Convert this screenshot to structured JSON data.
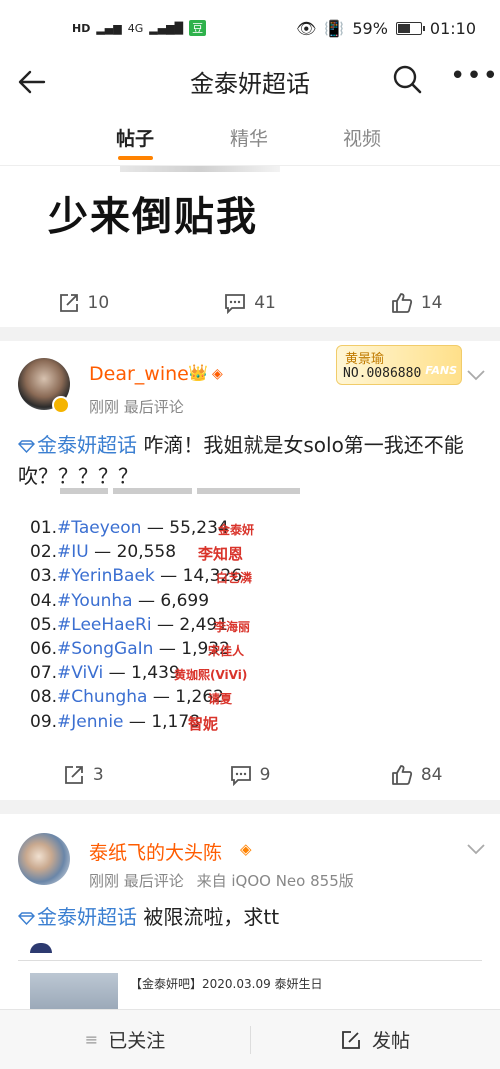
{
  "status_bar": {
    "left_icons": [
      "HD",
      "4G",
      "豆"
    ],
    "battery_percent": "59%",
    "battery_level": 0.59,
    "time": "01:10"
  },
  "nav": {
    "title": "金泰妍超话",
    "more_label": "•••"
  },
  "tabs": [
    {
      "label": "帖子",
      "active": true
    },
    {
      "label": "精华",
      "active": false
    },
    {
      "label": "视频",
      "active": false
    }
  ],
  "post1": {
    "image_text": "少来倒贴我",
    "actions": {
      "repost": "10",
      "comment": "41",
      "like": "14"
    }
  },
  "post2": {
    "user_name": "Dear_wine",
    "meta": "刚刚 最后评论",
    "fan_badge": {
      "name": "黄景瑜",
      "number": "NO.0086880",
      "word": "FANS"
    },
    "topic": "金泰妍超话",
    "text": "咋滴！我姐就是女solo第一我还不能吹？？？？？",
    "ranking": [
      {
        "rank": "01.",
        "tag": "#Taeyeon",
        "value": "55,234",
        "cn": "金泰妍"
      },
      {
        "rank": "02.",
        "tag": "#IU",
        "value": "20,558",
        "cn": "李知恩"
      },
      {
        "rank": "03.",
        "tag": "#YerinBaek",
        "value": "14,326",
        "cn": "白艺潾"
      },
      {
        "rank": "04.",
        "tag": "#Younha",
        "value": "6,699",
        "cn": ""
      },
      {
        "rank": "05.",
        "tag": "#LeeHaeRi",
        "value": "2,491",
        "cn": "李海丽"
      },
      {
        "rank": "06.",
        "tag": "#SongGaIn",
        "value": "1,932",
        "cn": "宋佳人"
      },
      {
        "rank": "07.",
        "tag": "#ViVi",
        "value": "1,439",
        "cn": "黄珈熙(ViVi)"
      },
      {
        "rank": "08.",
        "tag": "#Chungha",
        "value": "1,262",
        "cn": "请夏"
      },
      {
        "rank": "09.",
        "tag": "#Jennie",
        "value": "1,178",
        "cn": "智妮"
      }
    ],
    "actions": {
      "repost": "3",
      "comment": "9",
      "like": "84"
    }
  },
  "post3": {
    "user_name": "泰纸飞的大头陈",
    "meta_time": "刚刚 最后评论",
    "meta_from": "来自",
    "meta_device": "iQOO Neo 855版",
    "topic": "金泰妍超话",
    "text": "被限流啦，求tt",
    "embedded_title": "【金泰妍吧】2020.03.09 泰妍生日"
  },
  "bottom_bar": {
    "followed_label": "已关注",
    "post_label": "发帖"
  },
  "colors": {
    "accent_orange": "#ff8200",
    "username_orange": "#ff5c00",
    "link_blue": "#3b7fd1"
  }
}
